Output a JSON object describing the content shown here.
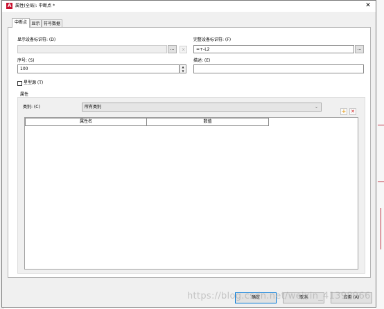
{
  "window": {
    "title": "属性(全局): 中断点 *",
    "app_icon_letter": "A",
    "close_glyph": "✕"
  },
  "tabs": [
    {
      "label": "中断点",
      "active": true
    },
    {
      "label": "显示",
      "active": false
    },
    {
      "label": "符号数据",
      "active": false
    }
  ],
  "fields": {
    "display_device_tag": {
      "label": "显示设备标识符: (D)",
      "value": "",
      "browse_label": "...",
      "clear_glyph": "✕"
    },
    "full_device_tag": {
      "label": "完整设备标识符: (F)",
      "value": "=+-L2",
      "browse_label": "..."
    },
    "sequence": {
      "label": "序号: (S)",
      "value": "100",
      "spin_up": "▲",
      "spin_down": "▼"
    },
    "description": {
      "label": "描述: (E)",
      "value": ""
    },
    "asterisk_source": {
      "label": "星型源 (T)",
      "checked": false
    }
  },
  "properties": {
    "group_label": "属性",
    "category_label": "类别: (C)",
    "category_value": "所有类别",
    "chevron_glyph": "⌄",
    "add_glyph": "+",
    "delete_glyph": "✕",
    "columns": [
      "属性名",
      "数值"
    ]
  },
  "buttons": {
    "ok": "确定",
    "cancel": "取消",
    "apply": "应用 (A)"
  },
  "watermark": "https://blog.csdn.net/weixin_41398966",
  "colors": {
    "accent": "#0078d7",
    "app_red": "#c8102e",
    "add_orange": "#e8a020",
    "delete_red": "#d02020"
  }
}
